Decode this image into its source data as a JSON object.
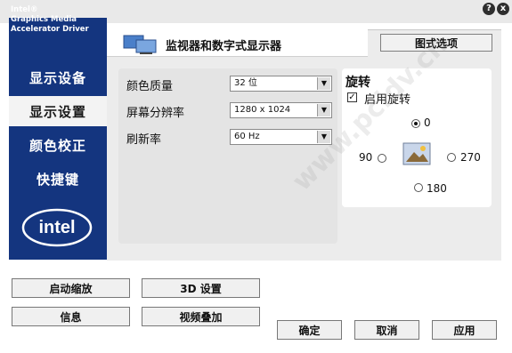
{
  "window": {
    "help_glyph": "?",
    "close_glyph": "x"
  },
  "brand": {
    "line1": "Intel®",
    "line2": "Graphics Media",
    "line3": "Accelerator Driver"
  },
  "nav": {
    "items": [
      {
        "label": "显示设备"
      },
      {
        "label": "显示设置"
      },
      {
        "label": "颜色校正"
      },
      {
        "label": "快捷键"
      }
    ]
  },
  "logo": {
    "text": "intel"
  },
  "main": {
    "title": "监视器和数字式显示器",
    "graphics_options": "图式选项",
    "color_quality": {
      "label": "颜色质量",
      "value": "32 位"
    },
    "resolution": {
      "label": "屏幕分辨率",
      "value": "1280 x 1024"
    },
    "refresh": {
      "label": "刷新率",
      "value": "60 Hz"
    }
  },
  "rotation": {
    "title": "旋转",
    "enable_label": "启用旋转",
    "enable_checked": true,
    "options": {
      "r0": "0",
      "r90": "90",
      "r180": "180",
      "r270": "270"
    },
    "selected": "0"
  },
  "buttons": {
    "start_zoom": "启动缩放",
    "settings3d": "3D 设置",
    "info": "信息",
    "video_overlay": "视频叠加",
    "ok": "确定",
    "cancel": "取消",
    "apply": "应用"
  },
  "watermark": {
    "text": "www.pcidv.cn"
  },
  "colors": {
    "nav_blue": "#14357f",
    "panel_gray": "#ececec"
  }
}
